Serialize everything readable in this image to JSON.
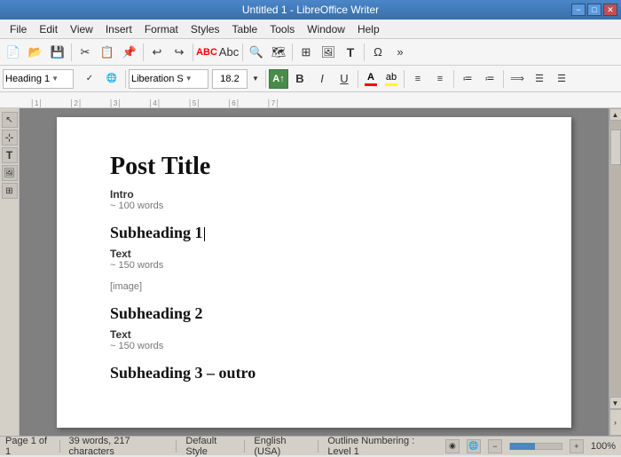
{
  "titlebar": {
    "title": "Untitled 1 - LibreOffice Writer",
    "minimize": "−",
    "maximize": "□",
    "close": "✕"
  },
  "menubar": {
    "items": [
      "File",
      "Edit",
      "View",
      "Insert",
      "Format",
      "Styles",
      "Table",
      "Tools",
      "Window",
      "Help"
    ]
  },
  "toolbar1": {
    "style_dropdown": "Heading 1",
    "font_dropdown": "Liberation S",
    "font_size": "18.2"
  },
  "document": {
    "post_title": "Post Title",
    "intro_label": "Intro",
    "intro_meta": "~ 100 words",
    "subheading1": "Subheading 1",
    "text1_label": "Text",
    "text1_meta": "~ 150 words",
    "image_placeholder": "[image]",
    "subheading2": "Subheading 2",
    "text2_label": "Text",
    "text2_meta": "~ 150 words",
    "subheading3": "Subheading 3 – outro"
  },
  "statusbar": {
    "page_info": "Page 1 of 1",
    "word_count": "39 words, 217 characters",
    "style": "Default Style",
    "language": "English (USA)",
    "outline": "Outline Numbering : Level 1"
  }
}
